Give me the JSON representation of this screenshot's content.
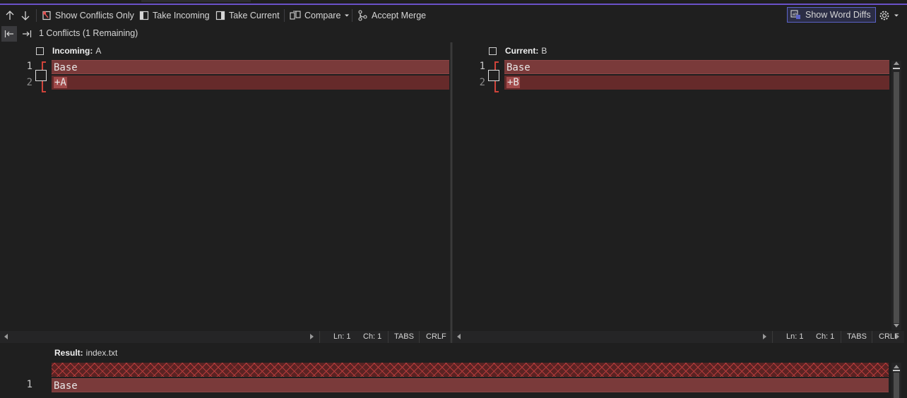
{
  "toolbar": {
    "prev_conflict": "previous-conflict",
    "next_conflict": "next-conflict",
    "show_conflicts_only": "Show Conflicts Only",
    "take_incoming": "Take Incoming",
    "take_current": "Take Current",
    "compare": "Compare",
    "accept_merge": "Accept Merge",
    "show_word_diffs": "Show Word Diffs"
  },
  "nav": {
    "conflicts_summary": "1 Conflicts (1 Remaining)"
  },
  "incoming": {
    "label": "Incoming:",
    "name": "A",
    "lines": [
      {
        "number": "1",
        "text": "Base"
      },
      {
        "number": "2",
        "text": "+A"
      }
    ],
    "status": {
      "ln": "Ln: 1",
      "ch": "Ch: 1",
      "tabs": "TABS",
      "eol": "CRLF"
    }
  },
  "current": {
    "label": "Current:",
    "name": "B",
    "lines": [
      {
        "number": "1",
        "text": "Base"
      },
      {
        "number": "2",
        "text": "+B"
      }
    ],
    "status": {
      "ln": "Ln: 1",
      "ch": "Ch: 1",
      "tabs": "TABS",
      "eol": "CRLF"
    }
  },
  "result": {
    "label": "Result:",
    "file": "index.txt",
    "lines": [
      {
        "number": "1",
        "text": "Base"
      }
    ]
  },
  "colors": {
    "accent": "#6a51c9",
    "conflict_red": "#d0433a",
    "diff_line": "#6b2b2b"
  }
}
